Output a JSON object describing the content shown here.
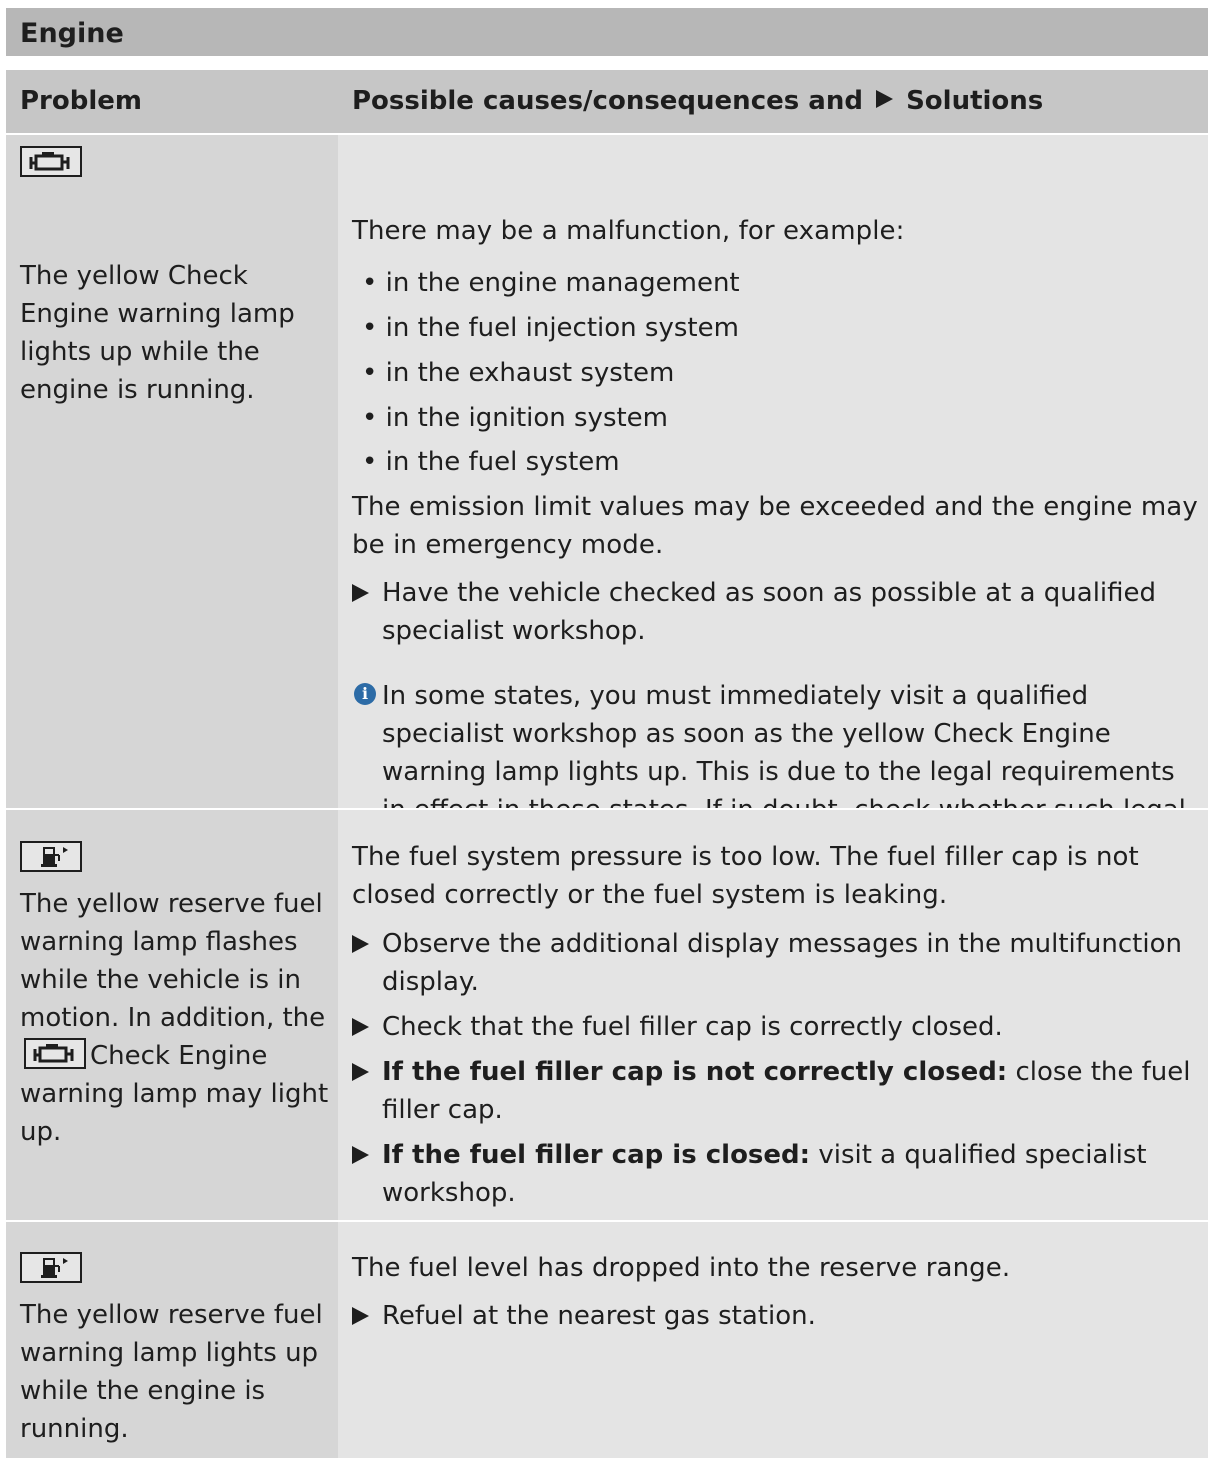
{
  "section": {
    "title": "Engine"
  },
  "header": {
    "problem": "Problem",
    "solutions_prefix": "Possible causes/consequences and",
    "solutions_suffix": "Solutions"
  },
  "rows": [
    {
      "lamp_icon": "check-engine-icon",
      "problem": "The yellow Check Engine warning lamp lights up while the engine is running.",
      "intro": "There may be a malfunction, for example:",
      "bullets": [
        "in the engine management",
        "in the fuel injection system",
        "in the exhaust system",
        "in the ignition system",
        "in the fuel system"
      ],
      "consequence": "The emission limit values may be exceeded and the engine may be in emergency mode.",
      "step1": "Have the vehicle checked as soon as possible at a qualified specialist workshop.",
      "note": "In some states, you must immediately visit a qualified specialist workshop as soon as the yellow Check Engine warning lamp lights up. This is due to the legal requirements in effect in these states. If in doubt, check whether such legal regulations apply in the state in which you are currently driving."
    },
    {
      "lamp_icon": "reserve-fuel-icon",
      "problem_part1": "The yellow reserve fuel warning lamp flashes while the vehicle is in motion. In addition, the",
      "problem_inline_icon": "check-engine-icon",
      "problem_part2": "Check Engine warning lamp may light up.",
      "intro": "The fuel system pressure is too low. The fuel filler cap is not closed correctly or the fuel system is leaking.",
      "step1": "Observe the additional display messages in the multifunction display.",
      "step2": "Check that the fuel filler cap is correctly closed.",
      "step3_bold": "If the fuel filler cap is not correctly closed:",
      "step3_rest": "close the fuel filler cap.",
      "step4_bold": "If the fuel filler cap is closed:",
      "step4_rest": "visit a qualified specialist workshop."
    },
    {
      "lamp_icon": "reserve-fuel-icon",
      "problem": "The yellow reserve fuel warning lamp lights up while the engine is running.",
      "intro": "The fuel level has dropped into the reserve range.",
      "step1": "Refuel at the nearest gas station."
    }
  ],
  "colors": {
    "section_bar": "#b7b7b7",
    "header_bg": "#c6c6c6",
    "problem_col_bg": "#d6d6d6",
    "solution_col_bg": "#e4e4e4",
    "info_icon": "#2c6ba6"
  }
}
